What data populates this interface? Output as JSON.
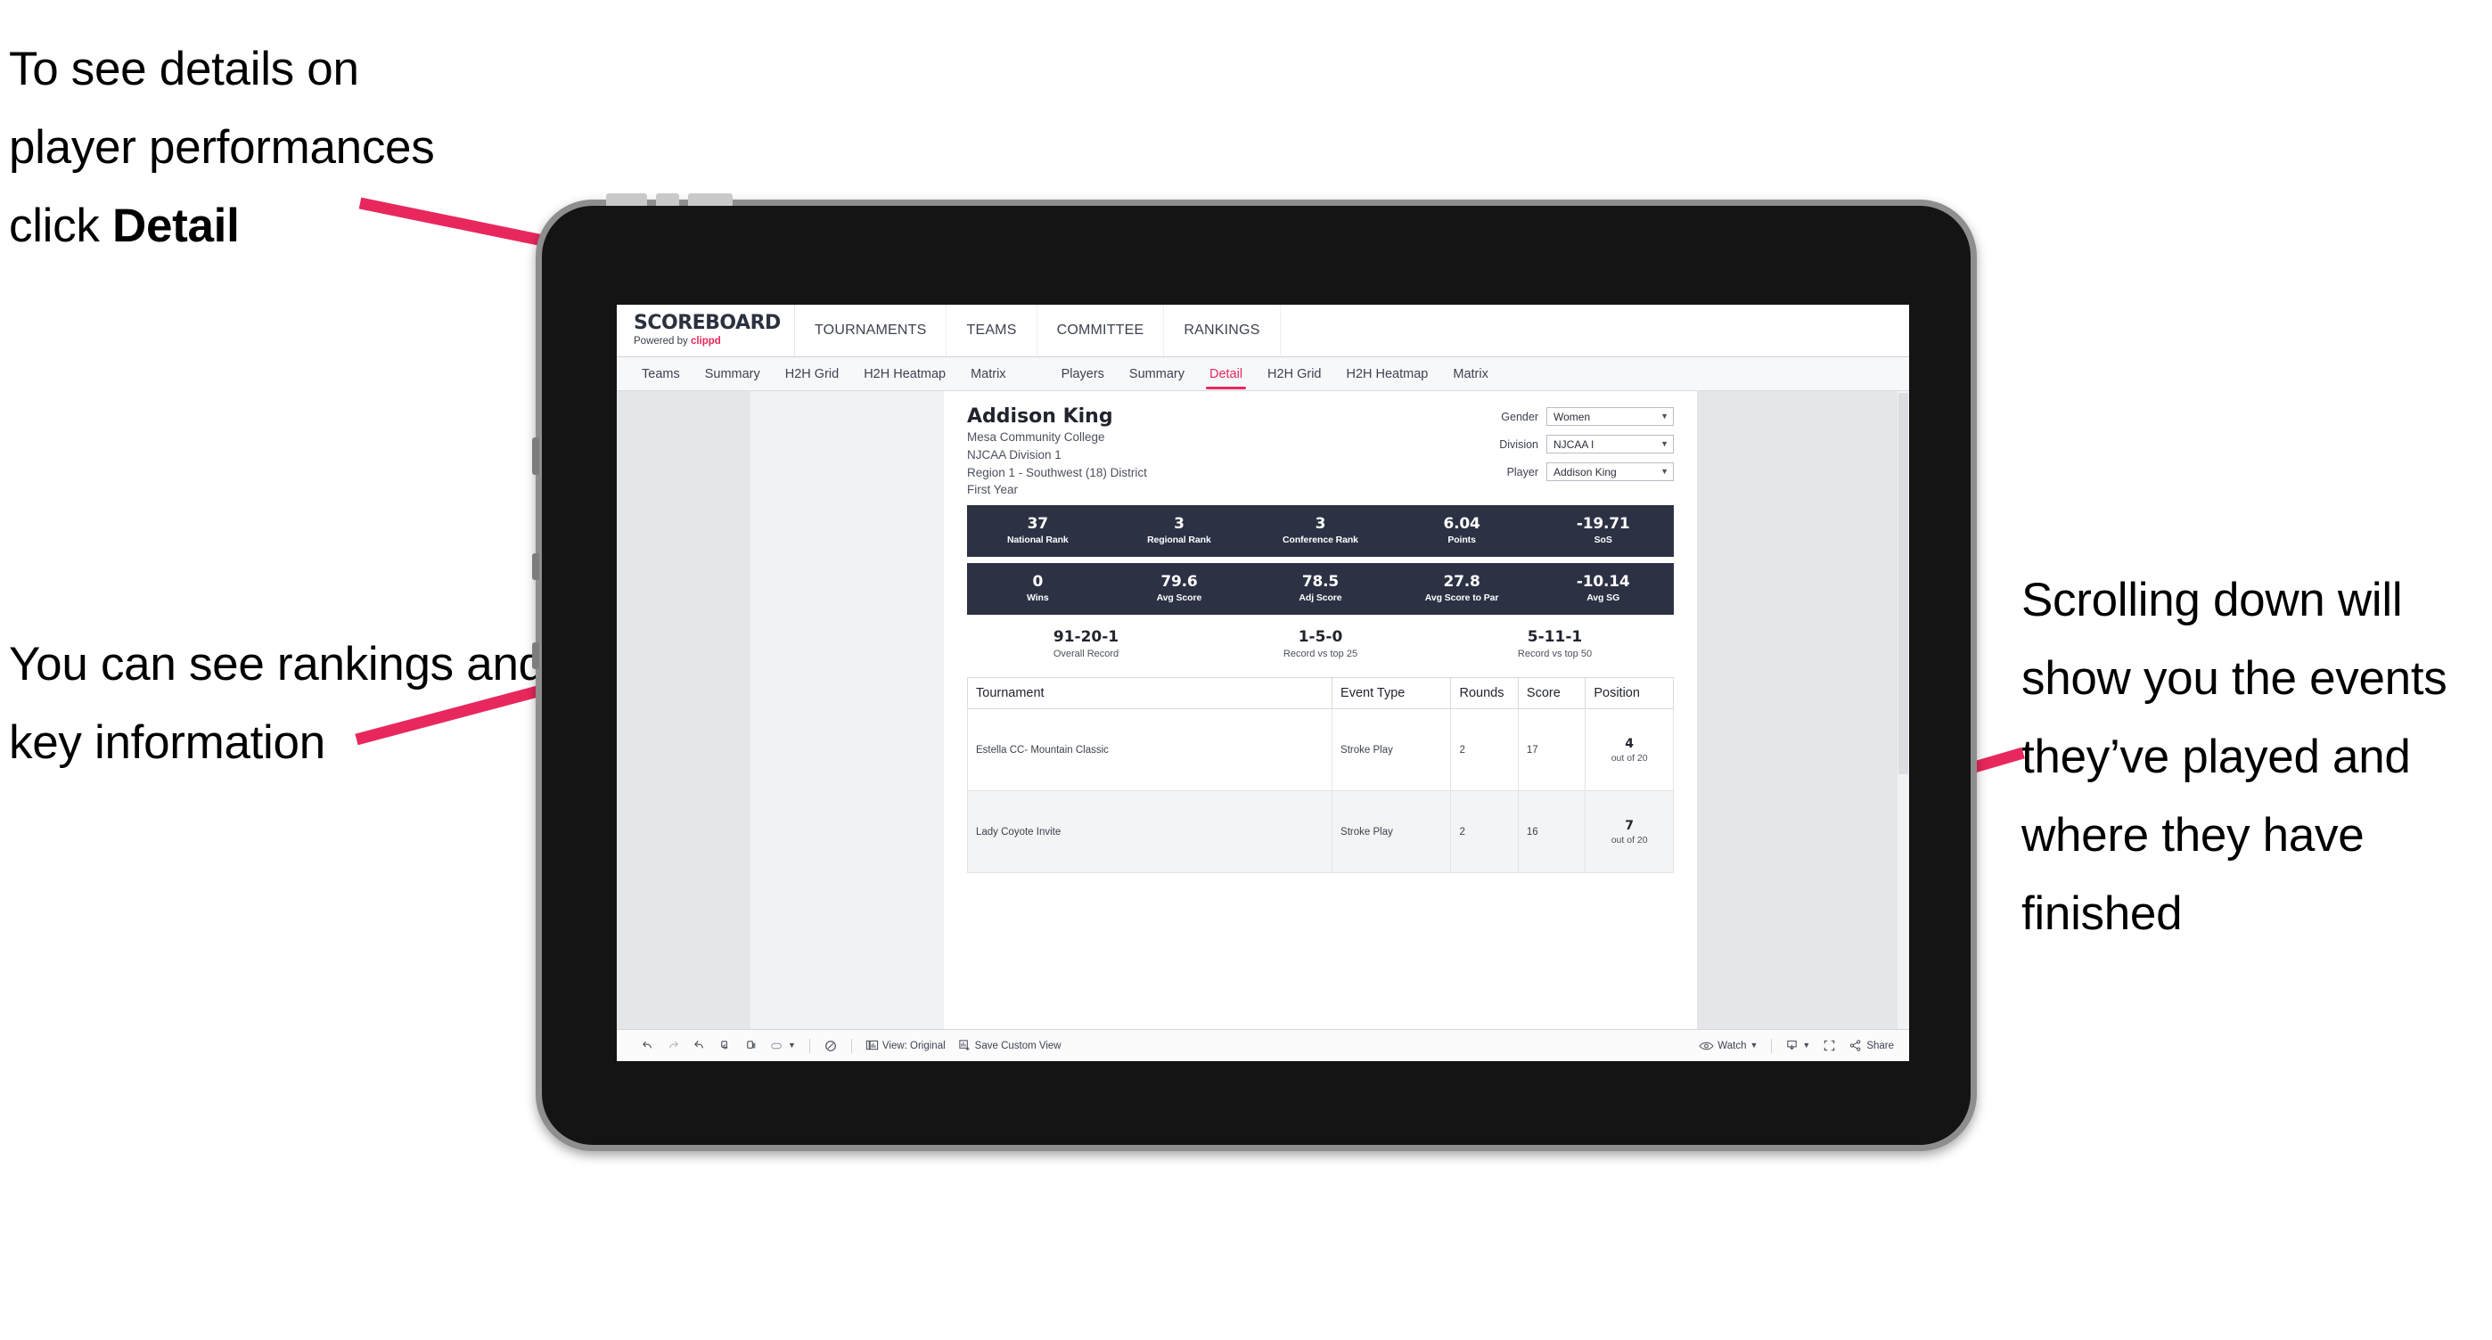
{
  "annotations": {
    "top_left": {
      "line1": "To see details on",
      "line2": "player performances",
      "line3_prefix": "click ",
      "line3_bold": "Detail"
    },
    "mid_left": "You can see rankings and key information",
    "right": "Scrolling down will show you the events they’ve played and where they have finished"
  },
  "app": {
    "brand": {
      "title": "SCOREBOARD",
      "powered_prefix": "Powered by ",
      "powered_brand": "clippd"
    },
    "top_nav": [
      "TOURNAMENTS",
      "TEAMS",
      "COMMITTEE",
      "RANKINGS"
    ],
    "sub_nav": {
      "group_teams": [
        "Teams",
        "Summary",
        "H2H Grid",
        "H2H Heatmap",
        "Matrix"
      ],
      "group_players": [
        "Players",
        "Summary",
        "Detail",
        "H2H Grid",
        "H2H Heatmap",
        "Matrix"
      ],
      "active": "Detail"
    },
    "accent_color": "#e8285c",
    "dark_bar_color": "#2c3144"
  },
  "player": {
    "name": "Addison King",
    "school": "Mesa Community College",
    "division": "NJCAA Division 1",
    "region": "Region 1 - Southwest (18) District",
    "year": "First Year"
  },
  "filters": [
    {
      "label": "Gender",
      "value": "Women"
    },
    {
      "label": "Division",
      "value": "NJCAA I"
    },
    {
      "label": "Player",
      "value": "Addison King"
    }
  ],
  "stats_row_1": [
    {
      "value": "37",
      "label": "National Rank"
    },
    {
      "value": "3",
      "label": "Regional Rank"
    },
    {
      "value": "3",
      "label": "Conference Rank"
    },
    {
      "value": "6.04",
      "label": "Points"
    },
    {
      "value": "-19.71",
      "label": "SoS"
    }
  ],
  "stats_row_2": [
    {
      "value": "0",
      "label": "Wins"
    },
    {
      "value": "79.6",
      "label": "Avg Score"
    },
    {
      "value": "78.5",
      "label": "Adj Score"
    },
    {
      "value": "27.8",
      "label": "Avg Score to Par"
    },
    {
      "value": "-10.14",
      "label": "Avg SG"
    }
  ],
  "records": [
    {
      "value": "91-20-1",
      "label": "Overall Record"
    },
    {
      "value": "1-5-0",
      "label": "Record vs top 25"
    },
    {
      "value": "5-11-1",
      "label": "Record vs top 50"
    }
  ],
  "table": {
    "headers": [
      "Tournament",
      "Event Type",
      "Rounds",
      "Score",
      "Position"
    ],
    "rows": [
      {
        "tournament": "Estella CC- Mountain Classic",
        "event_type": "Stroke Play",
        "rounds": "2",
        "score": "17",
        "position": "4",
        "position_of": "out of 20"
      },
      {
        "tournament": "Lady Coyote Invite",
        "event_type": "Stroke Play",
        "rounds": "2",
        "score": "16",
        "position": "7",
        "position_of": "out of 20"
      }
    ]
  },
  "toolbar": {
    "view_label": "View: Original",
    "save_label": "Save Custom View",
    "watch_label": "Watch",
    "share_label": "Share"
  }
}
